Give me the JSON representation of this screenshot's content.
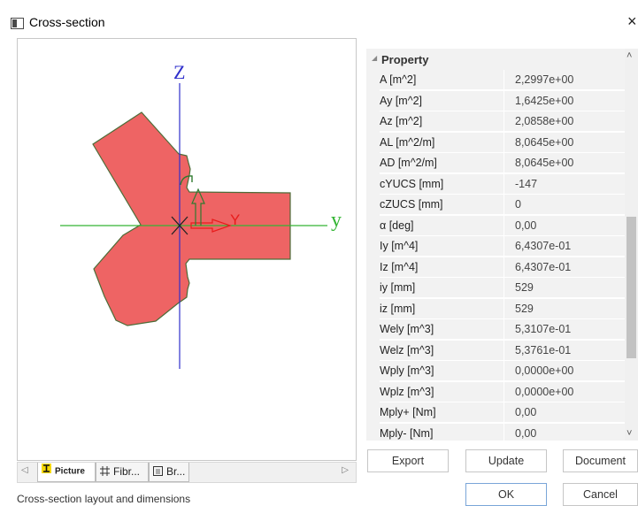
{
  "window": {
    "title": "Cross-section",
    "close_glyph": "×"
  },
  "canvas": {
    "axis_z": "Z",
    "axis_y": "y",
    "local_axis_y": "Y",
    "colors": {
      "shape_fill": "#ee6464",
      "shape_stroke": "#4d6c38",
      "axis_green": "#34b534",
      "axis_blue": "#3030cc",
      "local_y_red": "#e81c1c",
      "local_z_green": "#2f7a2f"
    }
  },
  "tabs": [
    {
      "label": "Picture",
      "icon": "i-section-icon"
    },
    {
      "label": "Fibr...",
      "icon": "fibers-grid-icon"
    },
    {
      "label": "Br...",
      "icon": "brief-list-icon"
    }
  ],
  "status": "Cross-section layout and dimensions",
  "properties": {
    "header": "Property",
    "rows": [
      {
        "name": "A [m^2]",
        "value": "2,2997e+00"
      },
      {
        "name": "Ay [m^2]",
        "value": "1,6425e+00"
      },
      {
        "name": "Az [m^2]",
        "value": "2,0858e+00"
      },
      {
        "name": "AL [m^2/m]",
        "value": "8,0645e+00"
      },
      {
        "name": "AD [m^2/m]",
        "value": "8,0645e+00"
      },
      {
        "name": "cYUCS [mm]",
        "value": "-147"
      },
      {
        "name": "cZUCS [mm]",
        "value": "0"
      },
      {
        "name": "α [deg]",
        "value": "0,00"
      },
      {
        "name": "Iy [m^4]",
        "value": "6,4307e-01"
      },
      {
        "name": "Iz [m^4]",
        "value": "6,4307e-01"
      },
      {
        "name": "iy [mm]",
        "value": "529"
      },
      {
        "name": "iz [mm]",
        "value": "529"
      },
      {
        "name": "Wely [m^3]",
        "value": "5,3107e-01"
      },
      {
        "name": "Welz [m^3]",
        "value": "5,3761e-01"
      },
      {
        "name": "Wply [m^3]",
        "value": "0,0000e+00"
      },
      {
        "name": "Wplz [m^3]",
        "value": "0,0000e+00"
      },
      {
        "name": "Mply+ [Nm]",
        "value": "0,00"
      },
      {
        "name": "Mply- [Nm]",
        "value": "0,00"
      }
    ]
  },
  "buttons": {
    "export": "Export",
    "update": "Update",
    "document": "Document",
    "ok": "OK",
    "cancel": "Cancel"
  }
}
